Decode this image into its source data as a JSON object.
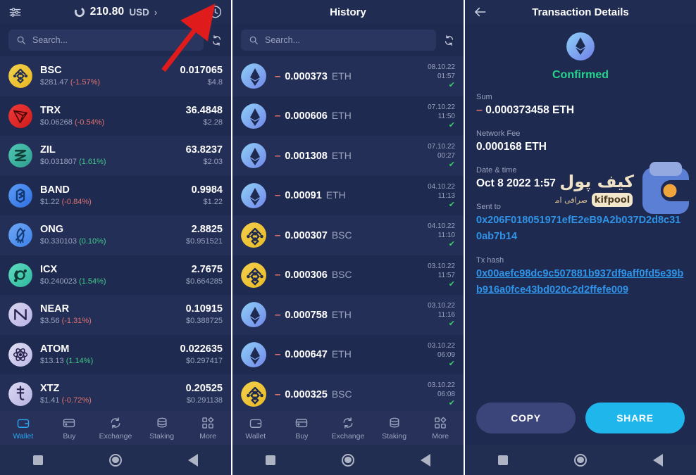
{
  "wallet": {
    "balance_amount": "210.80",
    "balance_currency": "USD",
    "chevron": "›",
    "search_placeholder": "Search...",
    "coins": [
      {
        "symbol": "BSC",
        "price": "$281.47",
        "change": "(-1.57%)",
        "dir": "down",
        "qty": "0.017065",
        "usd": "$4.8",
        "c1": "#f3d04e",
        "c2": "#e8b820",
        "glyph": "bsc"
      },
      {
        "symbol": "TRX",
        "price": "$0.06268",
        "change": "(-0.54%)",
        "dir": "down",
        "qty": "36.4848",
        "usd": "$2.28",
        "c1": "#f03a3a",
        "c2": "#d01b1b",
        "glyph": "trx"
      },
      {
        "symbol": "ZIL",
        "price": "$0.031807",
        "change": "(1.61%)",
        "dir": "up",
        "qty": "63.8237",
        "usd": "$2.03",
        "c1": "#4ec8b4",
        "c2": "#2f9d8e",
        "glyph": "zil"
      },
      {
        "symbol": "BAND",
        "price": "$1.22",
        "change": "(-0.84%)",
        "dir": "down",
        "qty": "0.9984",
        "usd": "$1.22",
        "c1": "#5b9cf7",
        "c2": "#2f6fe0",
        "glyph": "band"
      },
      {
        "symbol": "ONG",
        "price": "$0.330103",
        "change": "(0.10%)",
        "dir": "up",
        "qty": "2.8825",
        "usd": "$0.951521",
        "c1": "#6fa8f5",
        "c2": "#3c7fe8",
        "glyph": "ong"
      },
      {
        "symbol": "ICX",
        "price": "$0.240023",
        "change": "(1.54%)",
        "dir": "up",
        "qty": "2.7675",
        "usd": "$0.664285",
        "c1": "#5fdcc0",
        "c2": "#2fb79c",
        "glyph": "icx"
      },
      {
        "symbol": "NEAR",
        "price": "$3.56",
        "change": "(-1.31%)",
        "dir": "down",
        "qty": "0.10915",
        "usd": "$0.388725",
        "c1": "#d9d6f2",
        "c2": "#b9b4e4",
        "glyph": "near"
      },
      {
        "symbol": "ATOM",
        "price": "$13.13",
        "change": "(1.14%)",
        "dir": "up",
        "qty": "0.022635",
        "usd": "$0.297417",
        "c1": "#e2dff4",
        "c2": "#bdb8e6",
        "glyph": "atom"
      },
      {
        "symbol": "XTZ",
        "price": "$1.41",
        "change": "(-0.72%)",
        "dir": "down",
        "qty": "0.20525",
        "usd": "$0.291138",
        "c1": "#dcd9f3",
        "c2": "#b6b2e2",
        "glyph": "xtz"
      }
    ],
    "tabs": [
      {
        "label": "Wallet",
        "icon": "wallet-icon",
        "active": true
      },
      {
        "label": "Buy",
        "icon": "card-icon",
        "active": false
      },
      {
        "label": "Exchange",
        "icon": "exchange-icon",
        "active": false
      },
      {
        "label": "Staking",
        "icon": "stack-icon",
        "active": false
      },
      {
        "label": "More",
        "icon": "grid-icon",
        "active": false
      }
    ]
  },
  "history": {
    "title": "History",
    "search_placeholder": "Search...",
    "transactions": [
      {
        "amount": "0.000373",
        "symbol": "ETH",
        "date": "08.10.22",
        "time": "01:57",
        "status": "✔",
        "coin": "eth"
      },
      {
        "amount": "0.000606",
        "symbol": "ETH",
        "date": "07.10.22",
        "time": "11:50",
        "status": "✔",
        "coin": "eth"
      },
      {
        "amount": "0.001308",
        "symbol": "ETH",
        "date": "07.10.22",
        "time": "00:27",
        "status": "✔",
        "coin": "eth"
      },
      {
        "amount": "0.00091",
        "symbol": "ETH",
        "date": "04.10.22",
        "time": "11:13",
        "status": "✔",
        "coin": "eth"
      },
      {
        "amount": "0.000307",
        "symbol": "BSC",
        "date": "04.10.22",
        "time": "11:10",
        "status": "✔",
        "coin": "bsc"
      },
      {
        "amount": "0.000306",
        "symbol": "BSC",
        "date": "03.10.22",
        "time": "11:57",
        "status": "✔",
        "coin": "bsc"
      },
      {
        "amount": "0.000758",
        "symbol": "ETH",
        "date": "03.10.22",
        "time": "11:16",
        "status": "✔",
        "coin": "eth"
      },
      {
        "amount": "0.000647",
        "symbol": "ETH",
        "date": "03.10.22",
        "time": "06:09",
        "status": "✔",
        "coin": "eth"
      },
      {
        "amount": "0.000325",
        "symbol": "BSC",
        "date": "03.10.22",
        "time": "06:08",
        "status": "✔",
        "coin": "bsc"
      }
    ],
    "tabs": [
      {
        "label": "Wallet",
        "icon": "wallet-icon",
        "active": false
      },
      {
        "label": "Buy",
        "icon": "card-icon",
        "active": false
      },
      {
        "label": "Exchange",
        "icon": "exchange-icon",
        "active": false
      },
      {
        "label": "Staking",
        "icon": "stack-icon",
        "active": false
      },
      {
        "label": "More",
        "icon": "grid-icon",
        "active": false
      }
    ]
  },
  "details": {
    "title": "Transaction Details",
    "status": "Confirmed",
    "sum_label": "Sum",
    "sum_minus": "–",
    "sum_value": "0.000373458 ETH",
    "fee_label": "Network Fee",
    "fee_value": "0.000168 ETH",
    "datetime_label": "Date & time",
    "datetime_value": "Oct 8 2022 1:57",
    "sent_to_label": "Sent to",
    "sent_to_value": "0x206F018051971efE2eB9A2b037D2d8c310ab7b14",
    "tx_hash_label": "Tx hash",
    "tx_hash_value": "0x00aefc98dc9c507881b937df9aff0fd5e39bb916a0fce43bd020c2d2ffefe009",
    "copy_label": "COPY",
    "share_label": "SHARE",
    "watermark_main": "کیف پول من",
    "watermark_sub": "صرافی امن و سریع",
    "watermark_badge": "kifpool"
  },
  "colors": {
    "accent": "#2aa7f0",
    "share": "#1fb6ec",
    "confirmed": "#25d48c",
    "negative": "#e0736f",
    "positive": "#41c98a",
    "link": "#2f93e8",
    "bg": "#1f2a50",
    "row_alt": "#242f58",
    "arrow": "#e01b1b"
  }
}
